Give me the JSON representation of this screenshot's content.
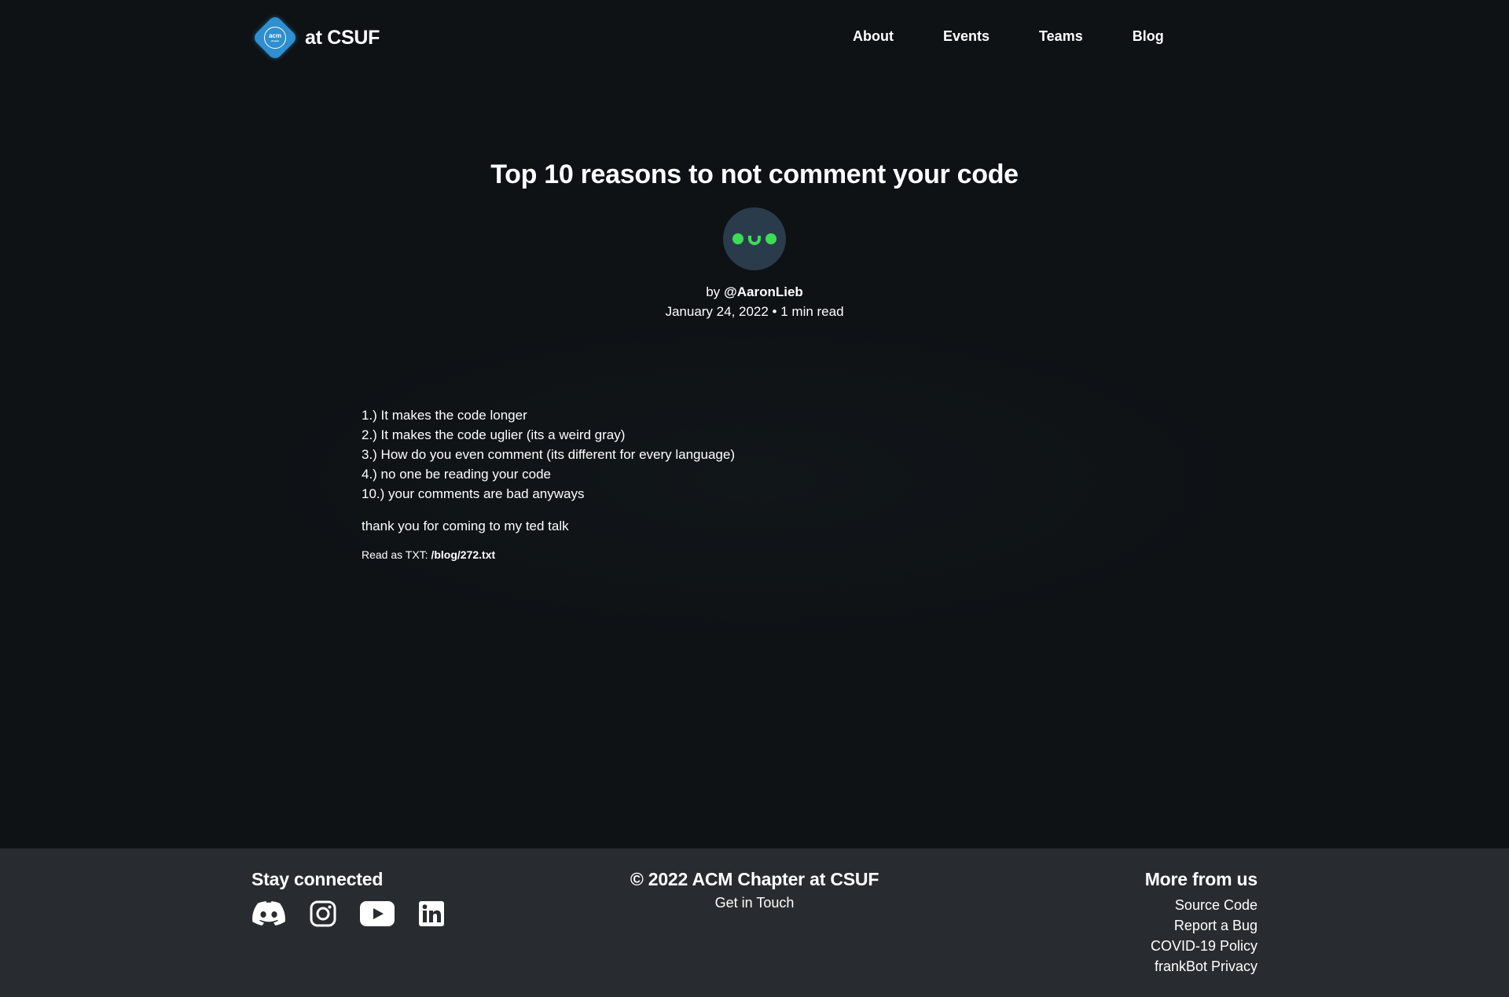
{
  "header": {
    "logo_mark": "acm",
    "logo_mark_sub": "chapter",
    "logo_text": "at CSUF",
    "nav": [
      {
        "label": "About"
      },
      {
        "label": "Events"
      },
      {
        "label": "Teams"
      },
      {
        "label": "Blog"
      }
    ]
  },
  "post": {
    "title": "Top 10 reasons to not comment your code",
    "author_prefix": "by",
    "author": "@AaronLieb",
    "meta": "January 24, 2022 • 1 min read",
    "lines": [
      "1.) It makes the code longer",
      "2.) It makes the code uglier (its a weird gray)",
      "3.) How do you even comment (its different for every language)",
      "4.) no one be reading your code",
      "10.) your comments are bad anyways"
    ],
    "closing": "thank you for coming to my ted talk",
    "txt_label": "Read as TXT:",
    "txt_path": "/blog/272.txt"
  },
  "footer": {
    "stay_connected": "Stay connected",
    "socials": [
      "discord-icon",
      "instagram-icon",
      "youtube-icon",
      "linkedin-icon"
    ],
    "copyright": "© 2022 ACM Chapter at CSUF",
    "get_in_touch": "Get in Touch",
    "more_from_us": "More from us",
    "links": [
      "Source Code",
      "Report a Bug",
      "COVID-19 Policy",
      "frankBot Privacy"
    ]
  },
  "colors": {
    "background": "#0e1215",
    "footer_background": "#282c30",
    "logo_blue": "#2f8fcf",
    "avatar_bg": "#2a3b4c",
    "avatar_face": "#3ddc57"
  }
}
